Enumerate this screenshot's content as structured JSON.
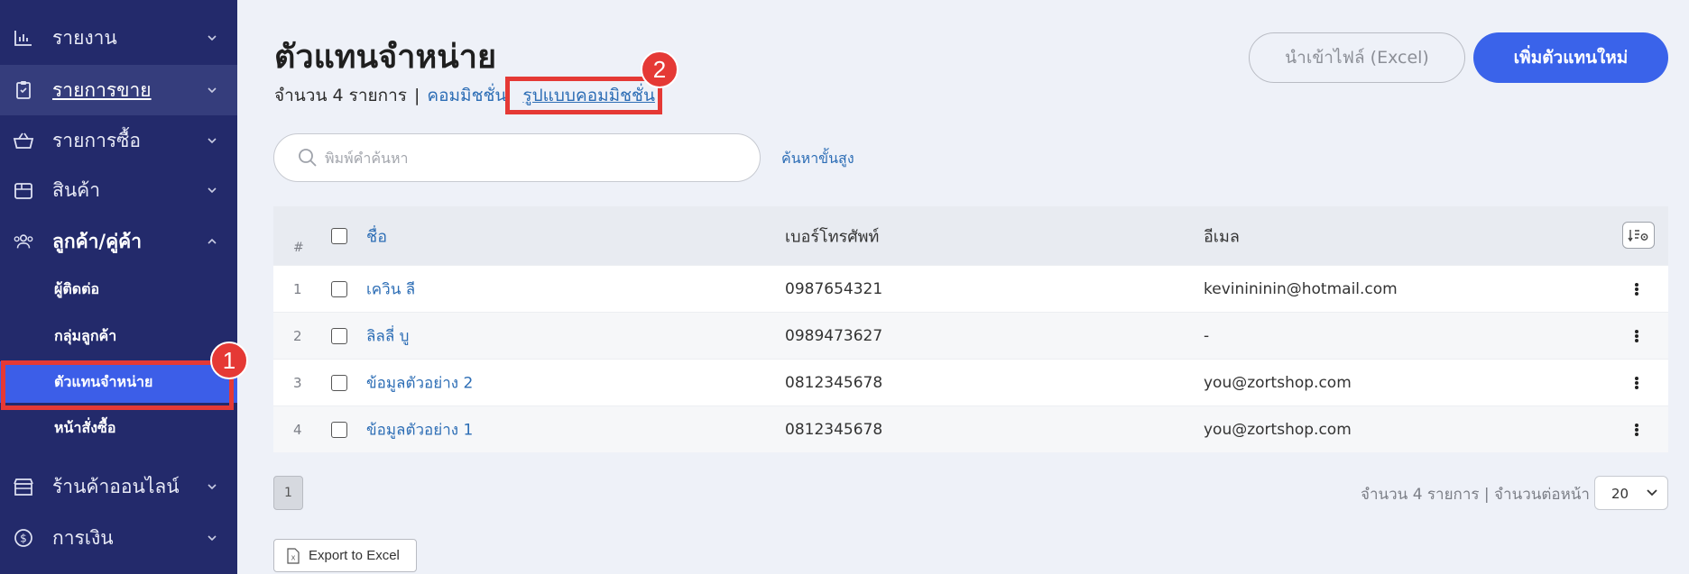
{
  "sidebar": {
    "items": [
      {
        "label": "รายงาน",
        "icon": "bar-chart-icon"
      },
      {
        "label": "รายการขาย",
        "icon": "clipboard-icon"
      },
      {
        "label": "รายการซื้อ",
        "icon": "basket-icon"
      },
      {
        "label": "สินค้า",
        "icon": "box-icon"
      },
      {
        "label": "ลูกค้า/คู่ค้า",
        "icon": "users-icon"
      },
      {
        "label": "ร้านค้าออนไลน์",
        "icon": "store-icon"
      },
      {
        "label": "การเงิน",
        "icon": "dollar-circle-icon"
      }
    ],
    "sub_items": [
      {
        "label": "ผู้ติดต่อ"
      },
      {
        "label": "กลุ่มลูกค้า"
      },
      {
        "label": "ตัวแทนจำหน่าย"
      },
      {
        "label": "หน้าสั่งซื้อ"
      }
    ],
    "colors": {
      "background": "#232a6b",
      "selected": "#3c5ee8"
    }
  },
  "annotations": {
    "step1": "1",
    "step2": "2",
    "color": "#e53935"
  },
  "header": {
    "title": "ตัวแทนจำหน่าย",
    "count_text": "จำนวน 4 รายการ",
    "separator": "|",
    "commission_link": "คอมมิชชั่น",
    "commission_format_link": "รูปแบบคอมมิชชั่น",
    "import_button": "นำเข้าไฟล์ (Excel)",
    "add_button": "เพิ่มตัวแทนใหม่",
    "accent": "#3a63ea"
  },
  "search": {
    "placeholder": "พิมพ์คำค้นหา",
    "advanced_link": "ค้นหาขั้นสูง"
  },
  "table": {
    "headers": {
      "num": "#",
      "name": "ชื่อ",
      "phone": "เบอร์โทรศัพท์",
      "email": "อีเมล"
    },
    "rows": [
      {
        "num": "1",
        "name": "เควิน ลี",
        "phone": "0987654321",
        "email": "kevinininin@hotmail.com"
      },
      {
        "num": "2",
        "name": "ลิลลี่ บู",
        "phone": "0989473627",
        "email": "-"
      },
      {
        "num": "3",
        "name": "ข้อมูลตัวอย่าง 2",
        "phone": "0812345678",
        "email": "you@zortshop.com"
      },
      {
        "num": "4",
        "name": "ข้อมูลตัวอย่าง 1",
        "phone": "0812345678",
        "email": "you@zortshop.com"
      }
    ]
  },
  "pagination": {
    "current_page": "1",
    "info": "จำนวน 4 รายการ | จำนวนต่อหน้า",
    "per_page": "20"
  },
  "export": {
    "label": "Export to Excel"
  }
}
